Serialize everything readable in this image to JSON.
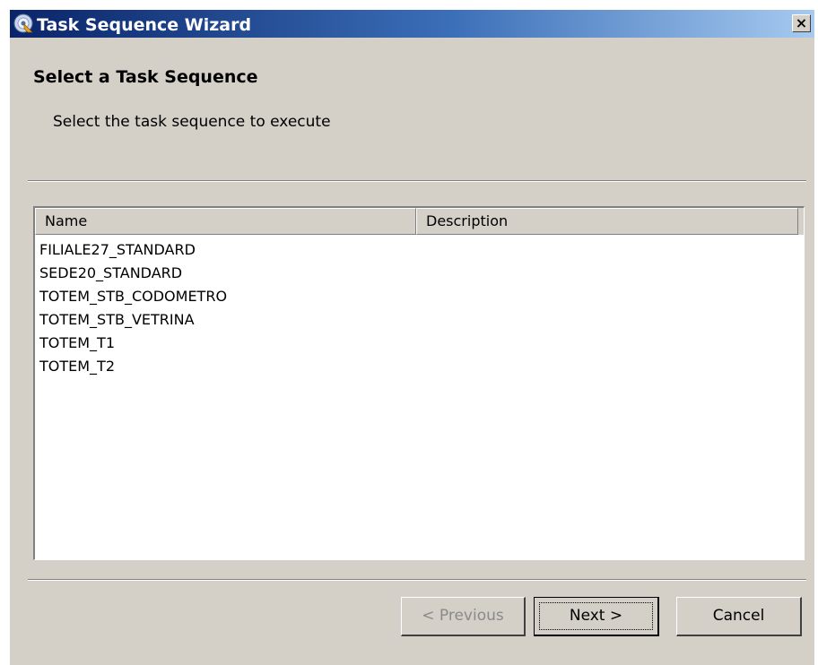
{
  "window": {
    "title": "Task Sequence Wizard",
    "close_label": "×"
  },
  "page": {
    "heading": "Select a Task Sequence",
    "subheading": "Select the task sequence to execute"
  },
  "list": {
    "columns": [
      "Name",
      "Description"
    ],
    "rows": [
      "FILIALE27_STANDARD",
      "SEDE20_STANDARD",
      "TOTEM_STB_CODOMETRO",
      "TOTEM_STB_VETRINA",
      "TOTEM_T1",
      "TOTEM_T2"
    ]
  },
  "buttons": {
    "previous": "< Previous",
    "next": "Next >",
    "cancel": "Cancel",
    "previous_enabled": false
  },
  "colors": {
    "titlebar_start": "#0a246a",
    "titlebar_end": "#a6caf0",
    "dialog_bg": "#d4d0c8"
  },
  "icons": {
    "title_icon": "task-sequence-disc-icon",
    "close_icon": "close-icon"
  }
}
